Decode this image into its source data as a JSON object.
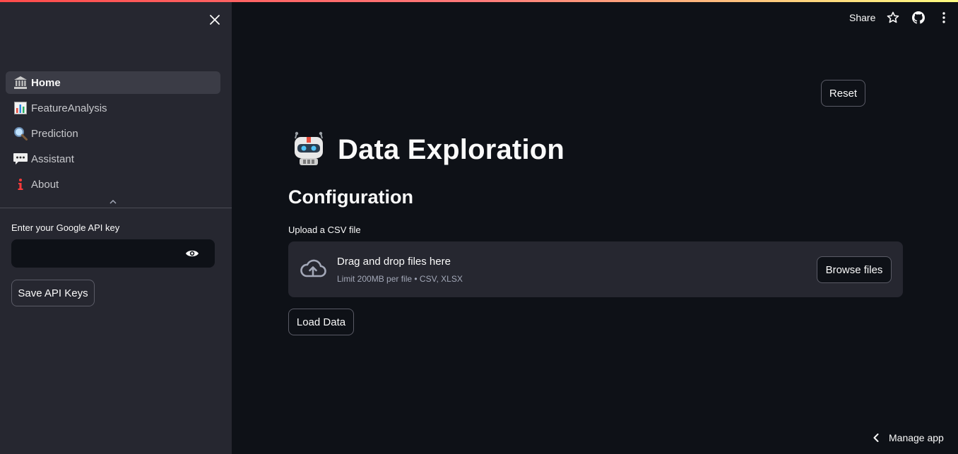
{
  "sidebar": {
    "nav": [
      {
        "label": "Home",
        "icon": "bank-icon",
        "active": true
      },
      {
        "label": "FeatureAnalysis",
        "icon": "bar-chart-icon",
        "active": false
      },
      {
        "label": "Prediction",
        "icon": "magnifier-icon",
        "active": false
      },
      {
        "label": "Assistant",
        "icon": "speech-bubble-icon",
        "active": false
      },
      {
        "label": "About",
        "icon": "info-icon",
        "active": false
      }
    ],
    "api_key_label": "Enter your Google API key",
    "api_key_value": "",
    "save_button": "Save API Keys"
  },
  "topbar": {
    "share": "Share"
  },
  "main": {
    "reset_button": "Reset",
    "title": "Data Exploration",
    "section": "Configuration",
    "upload_label": "Upload a CSV file",
    "dropzone_main": "Drag and drop files here",
    "dropzone_sub": "Limit 200MB per file • CSV, XLSX",
    "browse_button": "Browse files",
    "load_button": "Load Data"
  },
  "footer": {
    "manage_app": "Manage app"
  },
  "colors": {
    "background": "#0e1117",
    "sidebar": "#262730",
    "accent_red": "#ff4b4b"
  }
}
